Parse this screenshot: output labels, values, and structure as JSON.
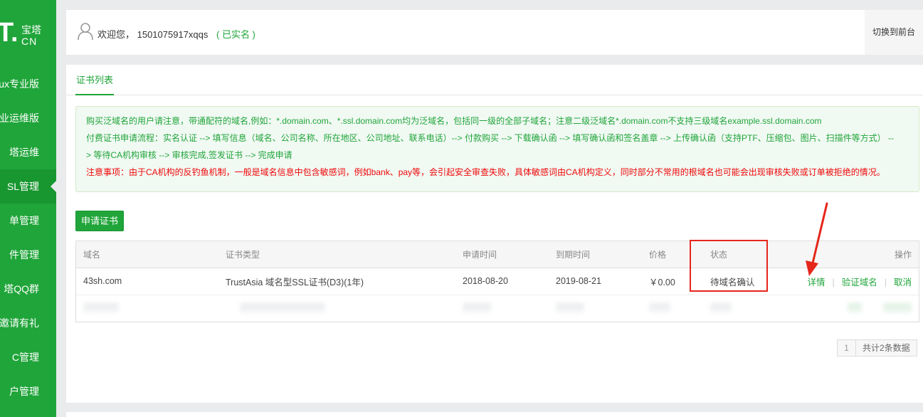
{
  "sidebar": {
    "logo": {
      "mark": "T.",
      "text_top": "宝塔",
      "text_bottom": "CN"
    },
    "items": [
      {
        "label": "ux专业版",
        "active": false
      },
      {
        "label": "业运维版",
        "active": false
      },
      {
        "label": "塔运维",
        "active": false
      },
      {
        "label": "SL管理",
        "active": true
      },
      {
        "label": "单管理",
        "active": false
      },
      {
        "label": "件管理",
        "active": false
      },
      {
        "label": "塔QQ群",
        "active": false
      },
      {
        "label": "邀请有礼",
        "active": false
      },
      {
        "label": "C管理",
        "active": false
      },
      {
        "label": "户管理",
        "active": false
      }
    ]
  },
  "header": {
    "welcome": "欢迎您， 1501075917xqqs",
    "verified": "( 已实名 )",
    "switch_label": "切换到前台",
    "user_icon": "user-icon"
  },
  "main": {
    "tab_label": "证书列表",
    "notice": {
      "line1": "购买泛域名的用户请注意，带通配符的域名,例如：*.domain.com、*.ssl.domain.com均为泛域名，包括同一级的全部子域名；注意二级泛域名*.domain.com不支持三级域名example.ssl.domain.com",
      "line2": "付费证书申请流程：实名认证 --> 填写信息（域名、公司名称、所在地区、公司地址、联系电话）--> 付款购买 --> 下载确认函 --> 填写确认函和签名盖章 --> 上传确认函（支持PTF、压缩包、图片、扫描件等方式） --",
      "line3": "> 等待CA机构审核 --> 审核完成,签发证书 --> 完成申请",
      "warning": "注意事项：由于CA机构的反钓鱼机制，一般是域名信息中包含敏感词，例如bank、pay等，会引起安全审查失败，具体敏感词由CA机构定义，同时部分不常用的根域名也可能会出现审核失败或订单被拒绝的情况。",
      "text_color": "#20a53a",
      "warning_color": "#ef0808"
    },
    "apply_button": "申请证书",
    "table": {
      "headers": {
        "domain": "域名",
        "cert_type": "证书类型",
        "apply_time": "申请时间",
        "expire_time": "到期时间",
        "price": "价格",
        "status": "状态",
        "actions": "操作"
      },
      "rows": [
        {
          "domain": "43sh.com",
          "cert_type": "TrustAsia 域名型SSL证书(D3)(1年)",
          "apply_time": "2018-08-20",
          "expire_time": "2019-08-21",
          "price": "￥0.00",
          "status": "待域名确认",
          "actions": {
            "detail": "详情",
            "verify": "验证域名",
            "cancel": "取消"
          }
        }
      ]
    },
    "pagination": {
      "current_page": "1",
      "total": "共计2条数据"
    }
  },
  "colors": {
    "brand": "#20a53a",
    "highlight_box": "#e5261b"
  }
}
